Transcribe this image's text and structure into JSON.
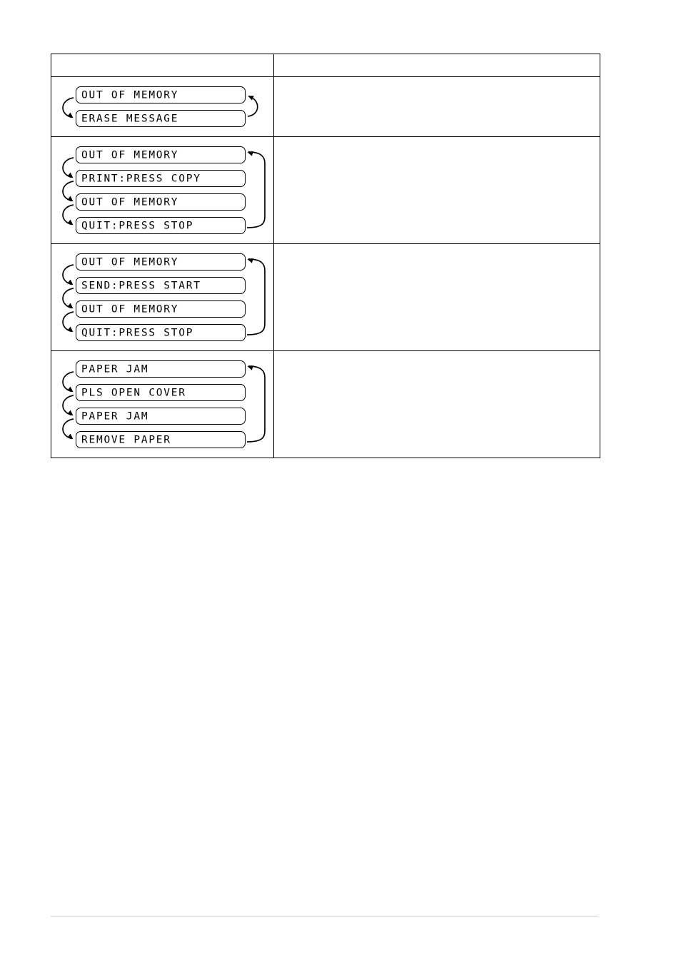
{
  "page": {
    "background_color": "#ffffff",
    "line_color": "#000000",
    "footer_rule_color": "#cccccc"
  },
  "table": {
    "name": "lcd-error-message-table",
    "columns": [
      {
        "key": "lcd_messages",
        "header": ""
      },
      {
        "key": "cause_action",
        "header": ""
      }
    ],
    "rows": [
      {
        "id": "row-out-of-memory-erase",
        "cause_action": "",
        "sequence": {
          "cycle": true,
          "boxes": [
            {
              "text": "OUT OF MEMORY"
            },
            {
              "text": "ERASE MESSAGE"
            }
          ]
        }
      },
      {
        "id": "row-out-of-memory-print",
        "cause_action": "",
        "sequence": {
          "cycle": true,
          "boxes": [
            {
              "text": "OUT OF MEMORY"
            },
            {
              "text": "PRINT:PRESS COPY"
            },
            {
              "text": "OUT OF MEMORY"
            },
            {
              "text": "QUIT:PRESS STOP"
            }
          ]
        }
      },
      {
        "id": "row-out-of-memory-send",
        "cause_action": "",
        "sequence": {
          "cycle": true,
          "boxes": [
            {
              "text": "OUT OF MEMORY"
            },
            {
              "text": "SEND:PRESS START"
            },
            {
              "text": "OUT OF MEMORY"
            },
            {
              "text": "QUIT:PRESS STOP"
            }
          ]
        }
      },
      {
        "id": "row-paper-jam",
        "cause_action": "",
        "sequence": {
          "cycle": true,
          "boxes": [
            {
              "text": "PAPER JAM"
            },
            {
              "text": "PLS OPEN COVER"
            },
            {
              "text": "PAPER JAM"
            },
            {
              "text": "REMOVE PAPER"
            }
          ]
        }
      }
    ]
  }
}
